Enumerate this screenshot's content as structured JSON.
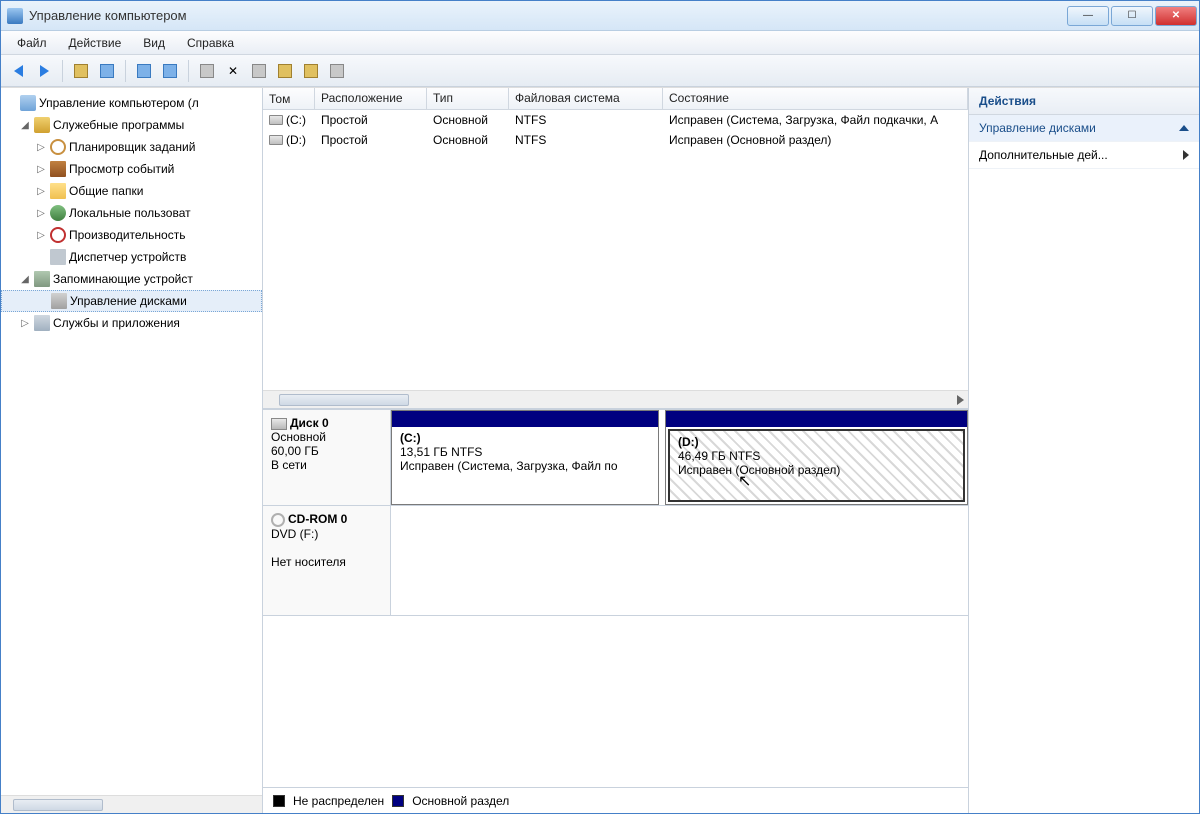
{
  "window": {
    "title": "Управление компьютером"
  },
  "menu": {
    "file": "Файл",
    "action": "Действие",
    "view": "Вид",
    "help": "Справка"
  },
  "tree": {
    "root": "Управление компьютером (л",
    "system_tools": "Служебные программы",
    "scheduler": "Планировщик заданий",
    "event_viewer": "Просмотр событий",
    "shared_folders": "Общие папки",
    "local_users": "Локальные пользоват",
    "performance": "Производительность",
    "device_mgr": "Диспетчер устройств",
    "storage": "Запоминающие устройст",
    "disk_mgmt": "Управление дисками",
    "services": "Службы и приложения"
  },
  "columns": {
    "volume": "Том",
    "layout": "Расположение",
    "type": "Тип",
    "fs": "Файловая система",
    "status": "Состояние"
  },
  "volumes": [
    {
      "vol": "(C:)",
      "layout": "Простой",
      "type": "Основной",
      "fs": "NTFS",
      "status": "Исправен (Система, Загрузка, Файл подкачки, А"
    },
    {
      "vol": "(D:)",
      "layout": "Простой",
      "type": "Основной",
      "fs": "NTFS",
      "status": "Исправен (Основной раздел)"
    }
  ],
  "disk0": {
    "name": "Диск 0",
    "type": "Основной",
    "size": "60,00 ГБ",
    "online": "В сети",
    "c_label": "(C:)",
    "c_size": "13,51 ГБ NTFS",
    "c_status": "Исправен (Система, Загрузка, Файл по",
    "d_label": "(D:)",
    "d_size": "46,49 ГБ NTFS",
    "d_status": "Исправен (Основной раздел)"
  },
  "cdrom": {
    "name": "CD-ROM 0",
    "sub": "DVD (F:)",
    "status": "Нет носителя"
  },
  "legend": {
    "unallocated": "Не распределен",
    "primary": "Основной раздел"
  },
  "actions": {
    "header": "Действия",
    "disk": "Управление дисками",
    "more": "Дополнительные дей..."
  }
}
